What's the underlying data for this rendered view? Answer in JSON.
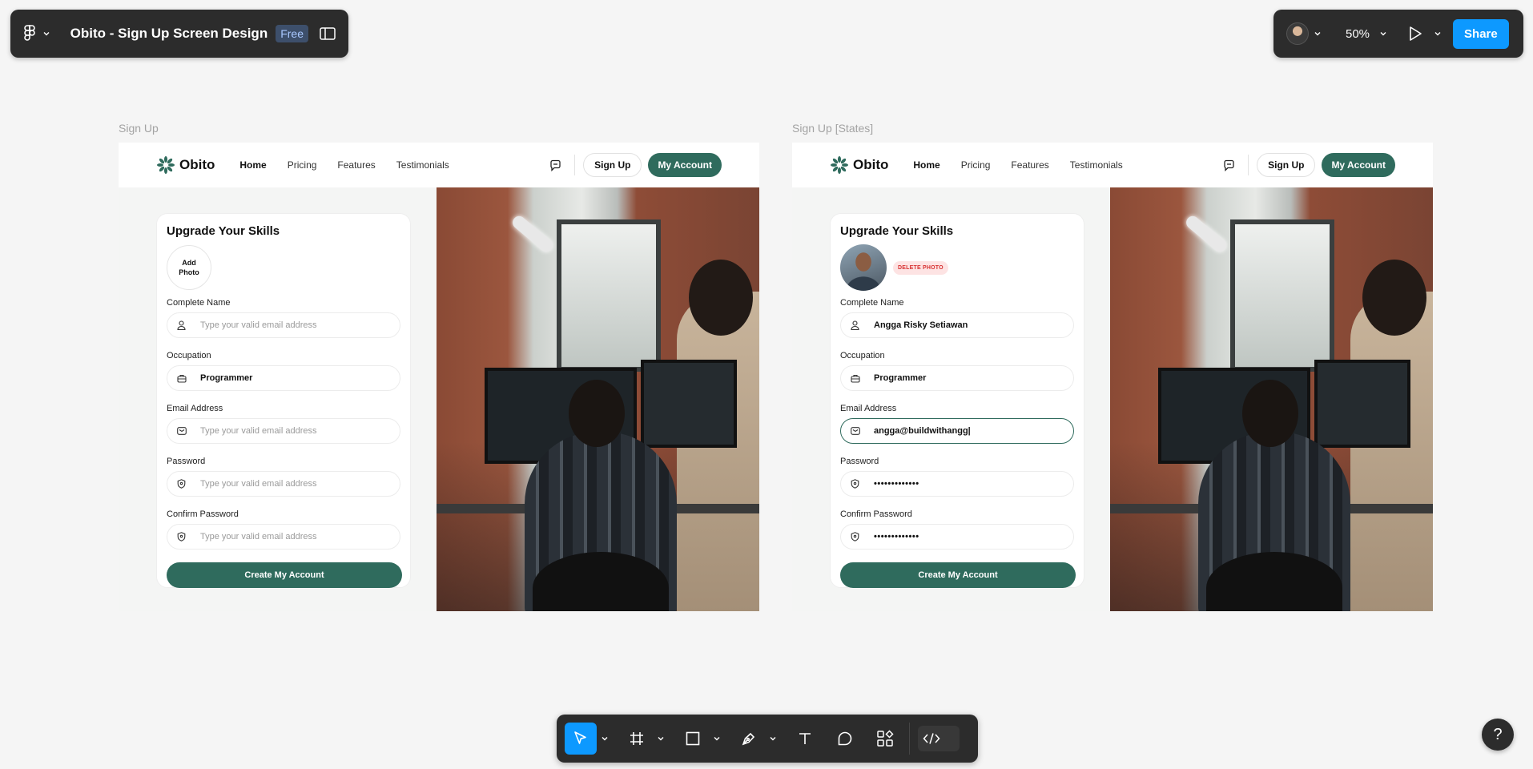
{
  "app": {
    "file_title": "Obito - Sign Up Screen Design",
    "plan_badge": "Free",
    "zoom": "50%",
    "share_label": "Share",
    "help_label": "?"
  },
  "frames": [
    {
      "label": "Sign Up",
      "nav": {
        "brand": "Obito",
        "links": [
          "Home",
          "Pricing",
          "Features",
          "Testimonials"
        ],
        "signup": "Sign Up",
        "account": "My Account"
      },
      "card": {
        "title": "Upgrade Your Skills",
        "add_photo": "Add Photo",
        "fields": [
          {
            "label": "Complete Name",
            "placeholder": "Type your valid email address",
            "value": ""
          },
          {
            "label": "Occupation",
            "placeholder": "",
            "value": "Programmer"
          },
          {
            "label": "Email Address",
            "placeholder": "Type your valid email address",
            "value": ""
          },
          {
            "label": "Password",
            "placeholder": "Type your valid email address",
            "value": ""
          },
          {
            "label": "Confirm Password",
            "placeholder": "Type your valid email address",
            "value": ""
          }
        ],
        "cta": "Create My Account"
      }
    },
    {
      "label": "Sign Up [States]",
      "nav": {
        "brand": "Obito",
        "links": [
          "Home",
          "Pricing",
          "Features",
          "Testimonials"
        ],
        "signup": "Sign Up",
        "account": "My Account"
      },
      "card": {
        "title": "Upgrade Your Skills",
        "delete_photo": "DELETE PHOTO",
        "fields": [
          {
            "label": "Complete Name",
            "value": "Angga Risky Setiawan"
          },
          {
            "label": "Occupation",
            "value": "Programmer"
          },
          {
            "label": "Email Address",
            "value": "angga@buildwithangg|"
          },
          {
            "label": "Password",
            "value": "•••••••••••••"
          },
          {
            "label": "Confirm Password",
            "value": "•••••••••••••"
          }
        ],
        "cta": "Create My Account"
      }
    }
  ],
  "colors": {
    "brand_green": "#2f6b5d",
    "figma_blue": "#0d99ff",
    "delete_red": "#d83232"
  }
}
